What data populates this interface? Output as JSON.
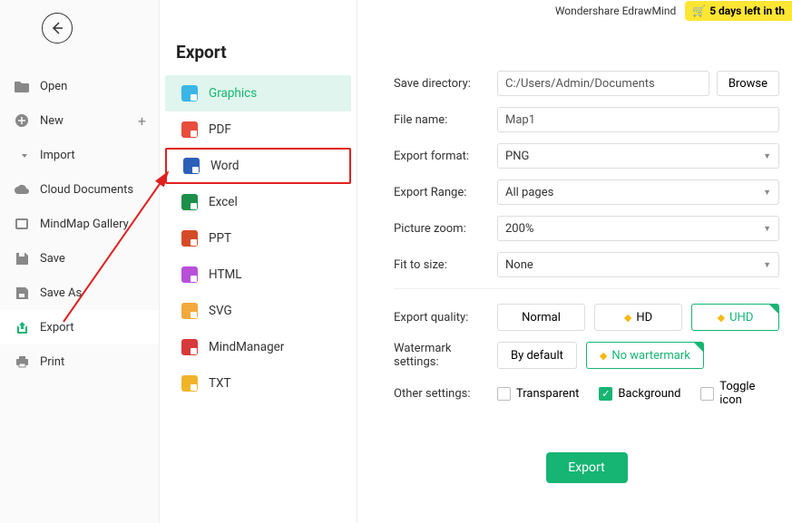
{
  "header": {
    "brand": "Wondershare EdrawMind",
    "trial": "5 days left in th"
  },
  "leftMenu": {
    "open": "Open",
    "new": "New",
    "import": "Import",
    "cloud": "Cloud Documents",
    "gallery": "MindMap Gallery",
    "save": "Save",
    "saveas": "Save As",
    "export": "Export",
    "print": "Print"
  },
  "mid": {
    "title": "Export",
    "formats": {
      "graphics": "Graphics",
      "pdf": "PDF",
      "word": "Word",
      "excel": "Excel",
      "ppt": "PPT",
      "html": "HTML",
      "svg": "SVG",
      "mindmanager": "MindManager",
      "txt": "TXT"
    }
  },
  "form": {
    "saveDir": {
      "label": "Save directory:",
      "value": "C:/Users/Admin/Documents",
      "browse": "Browse"
    },
    "fileName": {
      "label": "File name:",
      "value": "Map1"
    },
    "format": {
      "label": "Export format:",
      "value": "PNG"
    },
    "range": {
      "label": "Export Range:",
      "value": "All pages"
    },
    "zoom": {
      "label": "Picture zoom:",
      "value": "200%"
    },
    "fit": {
      "label": "Fit to size:",
      "value": "None"
    },
    "quality": {
      "label": "Export quality:",
      "normal": "Normal",
      "hd": "HD",
      "uhd": "UHD"
    },
    "watermark": {
      "label": "Watermark settings:",
      "default": "By default",
      "none": "No wartermark"
    },
    "other": {
      "label": "Other settings:",
      "transparent": "Transparent",
      "background": "Background",
      "toggle": "Toggle icon"
    },
    "exportBtn": "Export"
  }
}
